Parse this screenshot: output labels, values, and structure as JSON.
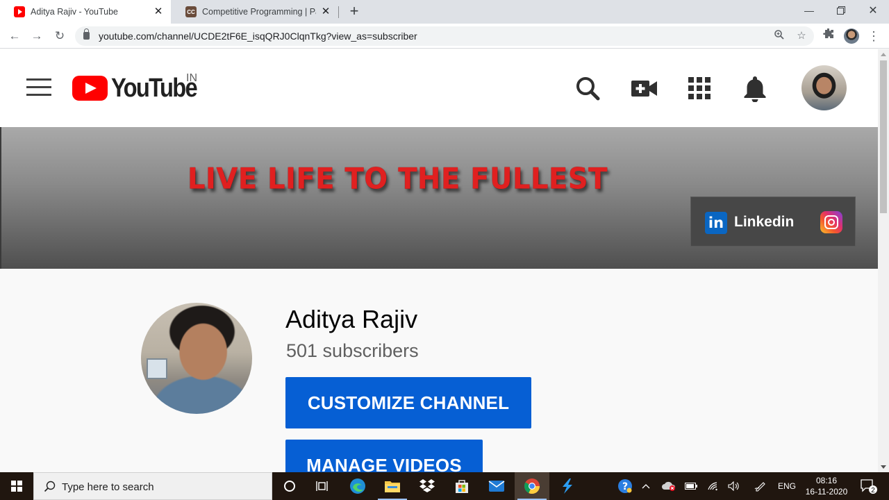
{
  "browser": {
    "tabs": [
      {
        "title": "Aditya Rajiv - YouTube",
        "favicon": "youtube-icon"
      },
      {
        "title": "Competitive Programming | Parti",
        "favicon": "codechef-icon",
        "favicon_text": "CC"
      }
    ],
    "url": "youtube.com/channel/UCDE2tF6E_isqQRJ0ClqnTkg?view_as=subscriber"
  },
  "youtube": {
    "logo_text": "YouTube",
    "region": "IN",
    "brand_color": "#ff0000"
  },
  "banner": {
    "tagline": "LIVE LIFE TO THE FULLEST",
    "linkedin_icon_text": "in",
    "linkedin_label": "Linkedin"
  },
  "channel": {
    "name": "Aditya Rajiv",
    "subscribers": "501 subscribers",
    "customize_label": "CUSTOMIZE CHANNEL",
    "manage_label": "MANAGE VIDEOS",
    "button_color": "#065fd4"
  },
  "taskbar": {
    "search_placeholder": "Type here to search",
    "language": "ENG",
    "time": "08:16",
    "date": "16-11-2020",
    "notification_count": "2"
  }
}
